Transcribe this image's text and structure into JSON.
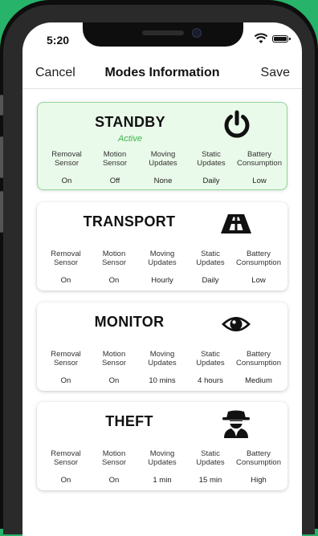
{
  "status_bar": {
    "time": "5:20"
  },
  "navbar": {
    "cancel": "Cancel",
    "title": "Modes Information",
    "save": "Save"
  },
  "stat_labels": {
    "removal": [
      "Removal",
      "Sensor"
    ],
    "motion": [
      "Motion",
      "Sensor"
    ],
    "moving": [
      "Moving",
      "Updates"
    ],
    "static": [
      "Static",
      "Updates"
    ],
    "battery": [
      "Battery",
      "Consumption"
    ]
  },
  "accent_colors": {
    "active_bg": "#eafaea",
    "active_border": "#8fd89a",
    "active_text": "#3bb54a",
    "frame": "#27b36a"
  },
  "modes": [
    {
      "name": "STANDBY",
      "status": "Active",
      "icon": "power-icon",
      "values": {
        "removal": "On",
        "motion": "Off",
        "moving": "None",
        "static": "Daily",
        "battery": "Low"
      }
    },
    {
      "name": "TRANSPORT",
      "icon": "road-icon",
      "values": {
        "removal": "On",
        "motion": "On",
        "moving": "Hourly",
        "static": "Daily",
        "battery": "Low"
      }
    },
    {
      "name": "MONITOR",
      "icon": "eye-icon",
      "values": {
        "removal": "On",
        "motion": "On",
        "moving": "10 mins",
        "static": "4 hours",
        "battery": "Medium"
      }
    },
    {
      "name": "THEFT",
      "icon": "thief-icon",
      "values": {
        "removal": "On",
        "motion": "On",
        "moving": "1 min",
        "static": "15 min",
        "battery": "High"
      }
    }
  ]
}
